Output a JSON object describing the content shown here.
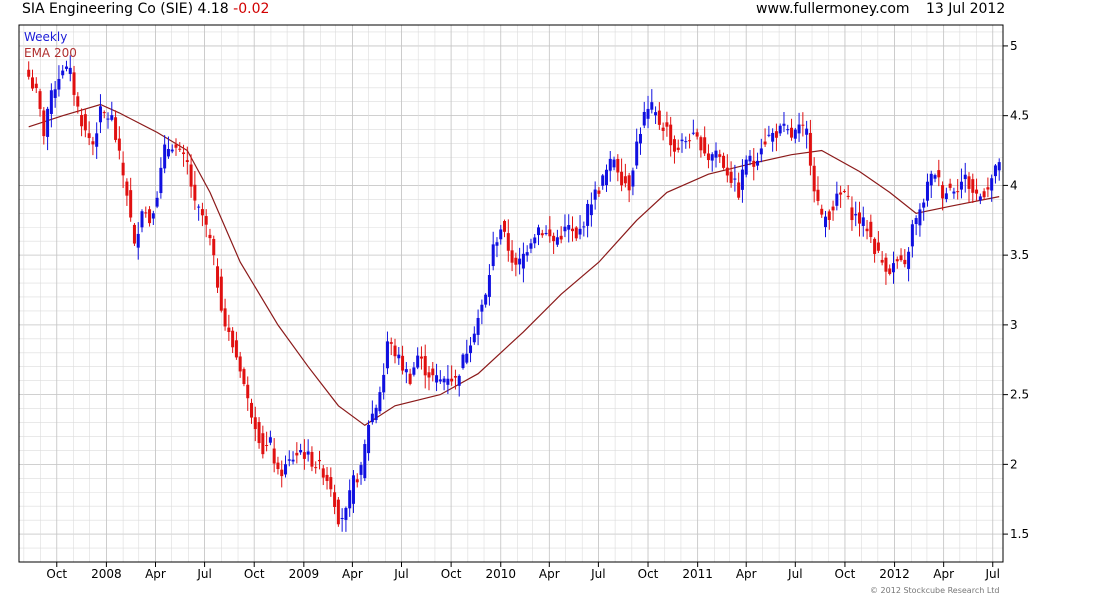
{
  "header": {
    "instrument": "SIA Engineering Co (SIE)",
    "last": "4.18",
    "change": "-0.02",
    "site": "www.fullermoney.com",
    "date": "13 Jul 2012"
  },
  "legend": {
    "weekly": "Weekly",
    "ema": "EMA 200"
  },
  "copyright": "© 2012 Stockcube Research Ltd",
  "colors": {
    "up": "#1010e0",
    "down": "#e01010",
    "ema": "#8b1a1a",
    "grid": "#dcdcdc"
  },
  "chart_data": {
    "type": "candlestick",
    "interval": "weekly",
    "x_tick_labels": [
      "Oct",
      "2008",
      "Apr",
      "Jul",
      "Oct",
      "2009",
      "Apr",
      "Jul",
      "Oct",
      "2010",
      "Apr",
      "Jul",
      "Oct",
      "2011",
      "Apr",
      "Jul",
      "Oct",
      "2012",
      "Apr",
      "Jul"
    ],
    "y_ticks": [
      1.5,
      2,
      2.5,
      3,
      3.5,
      4,
      4.5,
      5
    ],
    "ylim": [
      1.3,
      5.15
    ],
    "grid": true,
    "close_points": [
      [
        "2007-08-10",
        4.78
      ],
      [
        "2007-08-24",
        4.66
      ],
      [
        "2007-09-07",
        4.38
      ],
      [
        "2007-09-14",
        4.55
      ],
      [
        "2007-09-28",
        4.72
      ],
      [
        "2007-10-12",
        4.85
      ],
      [
        "2007-10-26",
        4.8
      ],
      [
        "2007-11-09",
        4.55
      ],
      [
        "2007-11-23",
        4.38
      ],
      [
        "2007-12-07",
        4.3
      ],
      [
        "2007-12-21",
        4.52
      ],
      [
        "2008-01-11",
        4.48
      ],
      [
        "2008-01-25",
        4.2
      ],
      [
        "2008-02-08",
        3.95
      ],
      [
        "2008-02-22",
        3.55
      ],
      [
        "2008-03-07",
        3.85
      ],
      [
        "2008-03-21",
        3.75
      ],
      [
        "2008-04-04",
        3.95
      ],
      [
        "2008-04-18",
        4.25
      ],
      [
        "2008-05-02",
        4.3
      ],
      [
        "2008-05-16",
        4.22
      ],
      [
        "2008-05-30",
        4.15
      ],
      [
        "2008-06-13",
        3.85
      ],
      [
        "2008-06-27",
        3.78
      ],
      [
        "2008-07-11",
        3.6
      ],
      [
        "2008-07-25",
        3.3
      ],
      [
        "2008-08-08",
        3.0
      ],
      [
        "2008-08-22",
        2.85
      ],
      [
        "2008-09-05",
        2.7
      ],
      [
        "2008-09-19",
        2.45
      ],
      [
        "2008-10-03",
        2.3
      ],
      [
        "2008-10-17",
        2.1
      ],
      [
        "2008-10-31",
        2.15
      ],
      [
        "2008-11-14",
        1.92
      ],
      [
        "2008-11-28",
        1.98
      ],
      [
        "2008-12-12",
        2.05
      ],
      [
        "2008-12-26",
        2.1
      ],
      [
        "2009-01-09",
        2.05
      ],
      [
        "2009-01-23",
        2.0
      ],
      [
        "2009-02-06",
        1.95
      ],
      [
        "2009-02-20",
        1.85
      ],
      [
        "2009-03-06",
        1.62
      ],
      [
        "2009-03-20",
        1.65
      ],
      [
        "2009-04-03",
        1.88
      ],
      [
        "2009-04-17",
        1.95
      ],
      [
        "2009-05-01",
        2.3
      ],
      [
        "2009-05-15",
        2.42
      ],
      [
        "2009-05-29",
        2.65
      ],
      [
        "2009-06-05",
        2.88
      ],
      [
        "2009-06-19",
        2.8
      ],
      [
        "2009-07-03",
        2.7
      ],
      [
        "2009-07-17",
        2.62
      ],
      [
        "2009-07-31",
        2.78
      ],
      [
        "2009-08-14",
        2.68
      ],
      [
        "2009-08-28",
        2.62
      ],
      [
        "2009-09-11",
        2.6
      ],
      [
        "2009-09-25",
        2.64
      ],
      [
        "2009-10-09",
        2.6
      ],
      [
        "2009-10-23",
        2.75
      ],
      [
        "2009-11-06",
        2.9
      ],
      [
        "2009-11-20",
        3.05
      ],
      [
        "2009-12-04",
        3.2
      ],
      [
        "2009-12-18",
        3.55
      ],
      [
        "2010-01-01",
        3.7
      ],
      [
        "2010-01-15",
        3.55
      ],
      [
        "2010-01-29",
        3.4
      ],
      [
        "2010-02-12",
        3.5
      ],
      [
        "2010-02-26",
        3.62
      ],
      [
        "2010-03-12",
        3.7
      ],
      [
        "2010-03-26",
        3.65
      ],
      [
        "2010-04-09",
        3.6
      ],
      [
        "2010-04-23",
        3.65
      ],
      [
        "2010-05-07",
        3.7
      ],
      [
        "2010-05-21",
        3.6
      ],
      [
        "2010-06-04",
        3.75
      ],
      [
        "2010-06-18",
        3.9
      ],
      [
        "2010-07-02",
        3.98
      ],
      [
        "2010-07-16",
        4.1
      ],
      [
        "2010-07-30",
        4.2
      ],
      [
        "2010-08-13",
        4.05
      ],
      [
        "2010-08-27",
        4.0
      ],
      [
        "2010-09-10",
        4.3
      ],
      [
        "2010-09-24",
        4.5
      ],
      [
        "2010-10-08",
        4.55
      ],
      [
        "2010-10-22",
        4.45
      ],
      [
        "2010-11-05",
        4.4
      ],
      [
        "2010-11-19",
        4.25
      ],
      [
        "2010-12-03",
        4.3
      ],
      [
        "2010-12-17",
        4.35
      ],
      [
        "2011-01-07",
        4.3
      ],
      [
        "2011-01-21",
        4.2
      ],
      [
        "2011-02-04",
        4.25
      ],
      [
        "2011-02-18",
        4.15
      ],
      [
        "2011-03-04",
        4.05
      ],
      [
        "2011-03-18",
        3.95
      ],
      [
        "2011-04-01",
        4.2
      ],
      [
        "2011-04-15",
        4.15
      ],
      [
        "2011-04-29",
        4.3
      ],
      [
        "2011-05-13",
        4.35
      ],
      [
        "2011-05-27",
        4.38
      ],
      [
        "2011-06-10",
        4.4
      ],
      [
        "2011-06-24",
        4.35
      ],
      [
        "2011-07-08",
        4.4
      ],
      [
        "2011-07-22",
        4.38
      ],
      [
        "2011-08-05",
        4.0
      ],
      [
        "2011-08-19",
        3.75
      ],
      [
        "2011-09-02",
        3.8
      ],
      [
        "2011-09-16",
        3.9
      ],
      [
        "2011-09-30",
        3.95
      ],
      [
        "2011-10-14",
        3.8
      ],
      [
        "2011-10-28",
        3.75
      ],
      [
        "2011-11-11",
        3.7
      ],
      [
        "2011-11-25",
        3.55
      ],
      [
        "2011-12-09",
        3.45
      ],
      [
        "2011-12-23",
        3.4
      ],
      [
        "2012-01-06",
        3.45
      ],
      [
        "2012-01-20",
        3.4
      ],
      [
        "2012-02-03",
        3.7
      ],
      [
        "2012-02-17",
        3.8
      ],
      [
        "2012-03-02",
        4.0
      ],
      [
        "2012-03-16",
        4.1
      ],
      [
        "2012-03-30",
        3.95
      ],
      [
        "2012-04-13",
        3.98
      ],
      [
        "2012-04-27",
        4.0
      ],
      [
        "2012-05-11",
        4.05
      ],
      [
        "2012-05-25",
        3.95
      ],
      [
        "2012-06-08",
        3.92
      ],
      [
        "2012-06-22",
        4.0
      ],
      [
        "2012-07-06",
        4.1
      ],
      [
        "2012-07-13",
        4.18
      ]
    ],
    "ema200_points": [
      [
        "2007-08-10",
        4.42
      ],
      [
        "2007-10-12",
        4.5
      ],
      [
        "2007-12-21",
        4.58
      ],
      [
        "2008-01-25",
        4.52
      ],
      [
        "2008-04-04",
        4.38
      ],
      [
        "2008-05-30",
        4.25
      ],
      [
        "2008-07-11",
        3.95
      ],
      [
        "2008-09-05",
        3.45
      ],
      [
        "2008-11-14",
        3.0
      ],
      [
        "2009-01-09",
        2.7
      ],
      [
        "2009-03-06",
        2.42
      ],
      [
        "2009-04-24",
        2.28
      ],
      [
        "2009-06-19",
        2.42
      ],
      [
        "2009-09-11",
        2.5
      ],
      [
        "2009-11-20",
        2.65
      ],
      [
        "2010-02-12",
        2.95
      ],
      [
        "2010-04-23",
        3.22
      ],
      [
        "2010-07-02",
        3.45
      ],
      [
        "2010-09-10",
        3.75
      ],
      [
        "2010-11-05",
        3.95
      ],
      [
        "2011-01-21",
        4.08
      ],
      [
        "2011-04-15",
        4.16
      ],
      [
        "2011-06-24",
        4.22
      ],
      [
        "2011-08-19",
        4.25
      ],
      [
        "2011-10-28",
        4.1
      ],
      [
        "2011-12-23",
        3.95
      ],
      [
        "2012-02-10",
        3.8
      ],
      [
        "2012-04-13",
        3.85
      ],
      [
        "2012-07-13",
        3.92
      ]
    ]
  }
}
